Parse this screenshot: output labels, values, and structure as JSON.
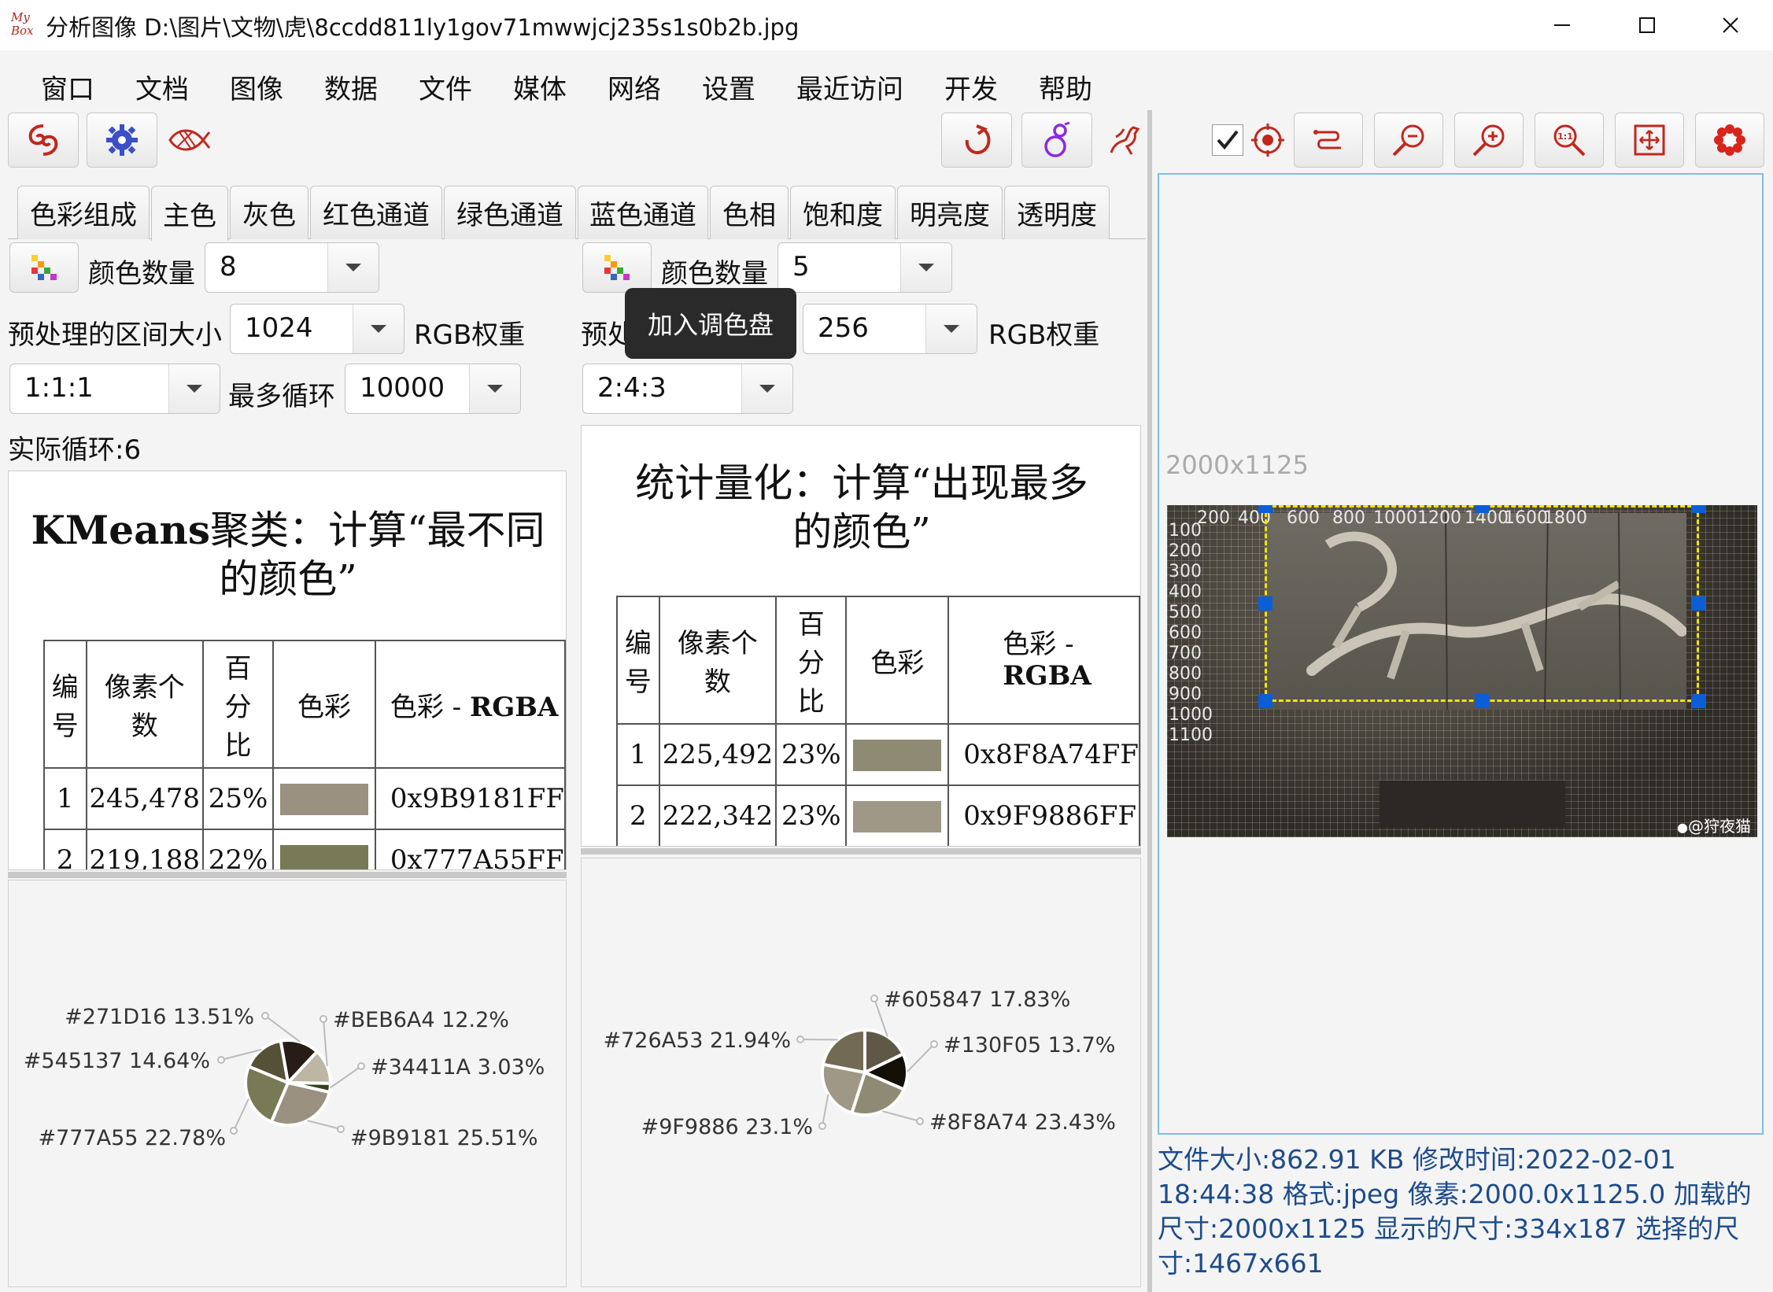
{
  "window": {
    "logo_top": "My",
    "logo_bottom": "Box",
    "title": "分析图像 D:\\图片\\文物\\虎\\8ccdd811ly1gov71mwwjcj235s1s0b2b.jpg"
  },
  "menu": [
    "窗口",
    "文档",
    "图像",
    "数据",
    "文件",
    "媒体",
    "网络",
    "设置",
    "最近访问",
    "开发",
    "帮助"
  ],
  "tabs": [
    "色彩组成",
    "主色",
    "灰色",
    "红色通道",
    "绿色通道",
    "蓝色通道",
    "色相",
    "饱和度",
    "明亮度",
    "透明度"
  ],
  "selected_tab": "主色",
  "tooltip": "加入调色盘",
  "left": {
    "color_count_label": "颜色数量",
    "color_count": "8",
    "region_label": "预处理的区间大小",
    "region_value": "1024",
    "rgb_weight_label": "RGB权重",
    "weight_value": "1:1:1",
    "max_loop_label": "最多循环",
    "max_loop_value": "10000",
    "actual_loop": "实际循环:6",
    "doc_title_line1": "KMeans聚类：计算“最不同",
    "doc_title_line2": "的颜色”",
    "headers": [
      "编号",
      "像素个数",
      "百分比",
      "色彩",
      "色彩 - RGBA"
    ],
    "header_parts": {
      "h1a": "编",
      "h1b": "号",
      "h2a": "像素个",
      "h2b": "数",
      "h3a": "百",
      "h3b": "分",
      "h3c": "比",
      "h4": "色彩",
      "h5a": "色彩 - ",
      "h5b": "RGBA"
    },
    "rows": [
      {
        "no": "1",
        "count": "245,478",
        "pct": "25%",
        "rgba": "0x9B9181FF",
        "color": "#9B9181"
      },
      {
        "no": "2",
        "count": "219,188",
        "pct": "22%",
        "rgba": "0x777A55FF",
        "color": "#777A55"
      }
    ]
  },
  "right": {
    "color_count_label": "颜色数量",
    "color_count": "5",
    "region_label": "预处理的区间大小",
    "region_value": "256",
    "rgb_weight_label": "RGB权重",
    "weight_value": "2:4:3",
    "doc_title_line1": "统计量化：计算“出现最多",
    "doc_title_line2": "的颜色”",
    "header_parts": {
      "h1a": "编",
      "h1b": "号",
      "h2a": "像素个",
      "h2b": "数",
      "h3a": "百",
      "h3b": "分",
      "h3c": "比",
      "h4": "色彩",
      "h5a": "色彩 - ",
      "h5b": "RGBA"
    },
    "rows": [
      {
        "no": "1",
        "count": "225,492",
        "pct": "23%",
        "rgba": "0x8F8A74FF",
        "color": "#8F8A74"
      },
      {
        "no": "2",
        "count": "222,342",
        "pct": "23%",
        "rgba": "0x9F9886FF",
        "color": "#9F9886"
      }
    ]
  },
  "chart_data": [
    {
      "type": "pie",
      "slices": [
        {
          "label": "#271D16",
          "value": 13.51,
          "color": "#271D16",
          "text": "#271D16  13.51%"
        },
        {
          "label": "#BEB6A4",
          "value": 12.2,
          "color": "#BEB6A4",
          "text": "#BEB6A4  12.2%"
        },
        {
          "label": "#34411A",
          "value": 3.03,
          "color": "#34411A",
          "text": "#34411A  3.03%"
        },
        {
          "label": "#9B9181",
          "value": 25.51,
          "color": "#9B9181",
          "text": "#9B9181  25.51%"
        },
        {
          "label": "#777A55",
          "value": 22.78,
          "color": "#777A55",
          "text": "#777A55  22.78%"
        },
        {
          "label": "#545137",
          "value": 14.64,
          "color": "#545137",
          "text": "#545137  14.64%"
        }
      ]
    },
    {
      "type": "pie",
      "slices": [
        {
          "label": "#605847",
          "value": 17.83,
          "color": "#605847",
          "text": "#605847  17.83%"
        },
        {
          "label": "#130F05",
          "value": 13.7,
          "color": "#130F05",
          "text": "#130F05  13.7%"
        },
        {
          "label": "#8F8A74",
          "value": 23.43,
          "color": "#8F8A74",
          "text": "#8F8A74  23.43%"
        },
        {
          "label": "#9F9886",
          "value": 23.1,
          "color": "#9F9886",
          "text": "#9F9886  23.1%"
        },
        {
          "label": "#726A53",
          "value": 21.94,
          "color": "#726A53",
          "text": "#726A53  21.94%"
        }
      ]
    }
  ],
  "image_view": {
    "size_label": "2000x1125",
    "x_ticks": [
      "200",
      "400",
      "600",
      "800",
      "1000",
      "1200",
      "1400",
      "1600",
      "1800"
    ],
    "y_ticks": [
      "100",
      "200",
      "300",
      "400",
      "500",
      "600",
      "700",
      "800",
      "900",
      "1000",
      "1100"
    ],
    "watermark": "@狩夜猫"
  },
  "status": "文件大小:862.91 KB  修改时间:2022-02-01 18:44:38  格式:jpeg  像素:2000.0x1125.0  加载的尺寸:2000x1125  显示的尺寸:334x187  选择的尺寸:1467x661"
}
